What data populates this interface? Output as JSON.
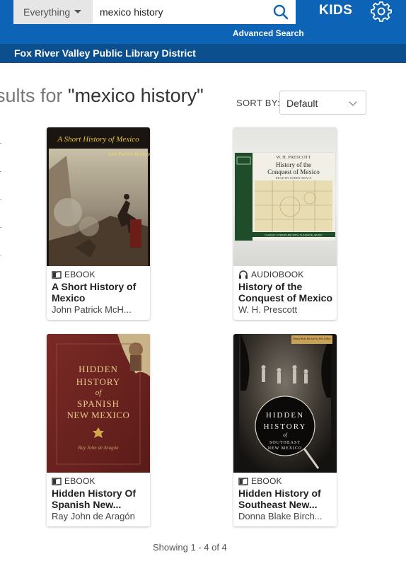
{
  "header": {
    "scope_label": "Everything",
    "search_value": "mexico history",
    "advanced_search": "Advanced Search",
    "kids_label": "KIDS",
    "library_name": "Fox River Valley Public Library District",
    "brand_color": "#0d64b6"
  },
  "results": {
    "heading_prefix": "sults for ",
    "query_display": "\"mexico history\"",
    "sort_label": "SORT BY:",
    "sort_value": "Default",
    "showing": "Showing 1 - 4 of 4"
  },
  "items": [
    {
      "format_icon": "book-icon",
      "format": "EBOOK",
      "title": "A Short History of Mexico",
      "author": "John Patrick McH...",
      "cover_title": "A Short History of Mexico",
      "cover_author": "John Patrick McHenry"
    },
    {
      "format_icon": "headphones-icon",
      "format": "AUDIOBOOK",
      "title": "History of the Conquest of Mexico",
      "author": "W. H. Prescott",
      "cover_author": "W. H. PRESCOTT",
      "cover_title": "History of the Conquest of Mexico",
      "cover_reader": "READ BY KERRY SHALE",
      "cover_band": "CLASSIC LITERATURE WITH CLASSICAL MUSIC"
    },
    {
      "format_icon": "book-icon",
      "format": "EBOOK",
      "title": "Hidden History Of Spanish New...",
      "author": "Ray John de Aragón",
      "cover_title_l1": "HIDDEN",
      "cover_title_l2": "HISTORY",
      "cover_title_l3": "of",
      "cover_title_l4": "SPANISH",
      "cover_title_l5": "NEW MEXICO",
      "cover_author": "Ray John de Aragón"
    },
    {
      "format_icon": "book-icon",
      "format": "EBOOK",
      "title": "Hidden History of Southeast New...",
      "author": "Donna Blake Birch...",
      "cover_authors": "Donna Blake Birchell & John LeMay",
      "cover_title_l1": "HIDDEN",
      "cover_title_l2": "HISTORY",
      "cover_title_l3": "of",
      "cover_title_l4": "SOUTHEAST",
      "cover_title_l5": "NEW MEXICO"
    }
  ]
}
